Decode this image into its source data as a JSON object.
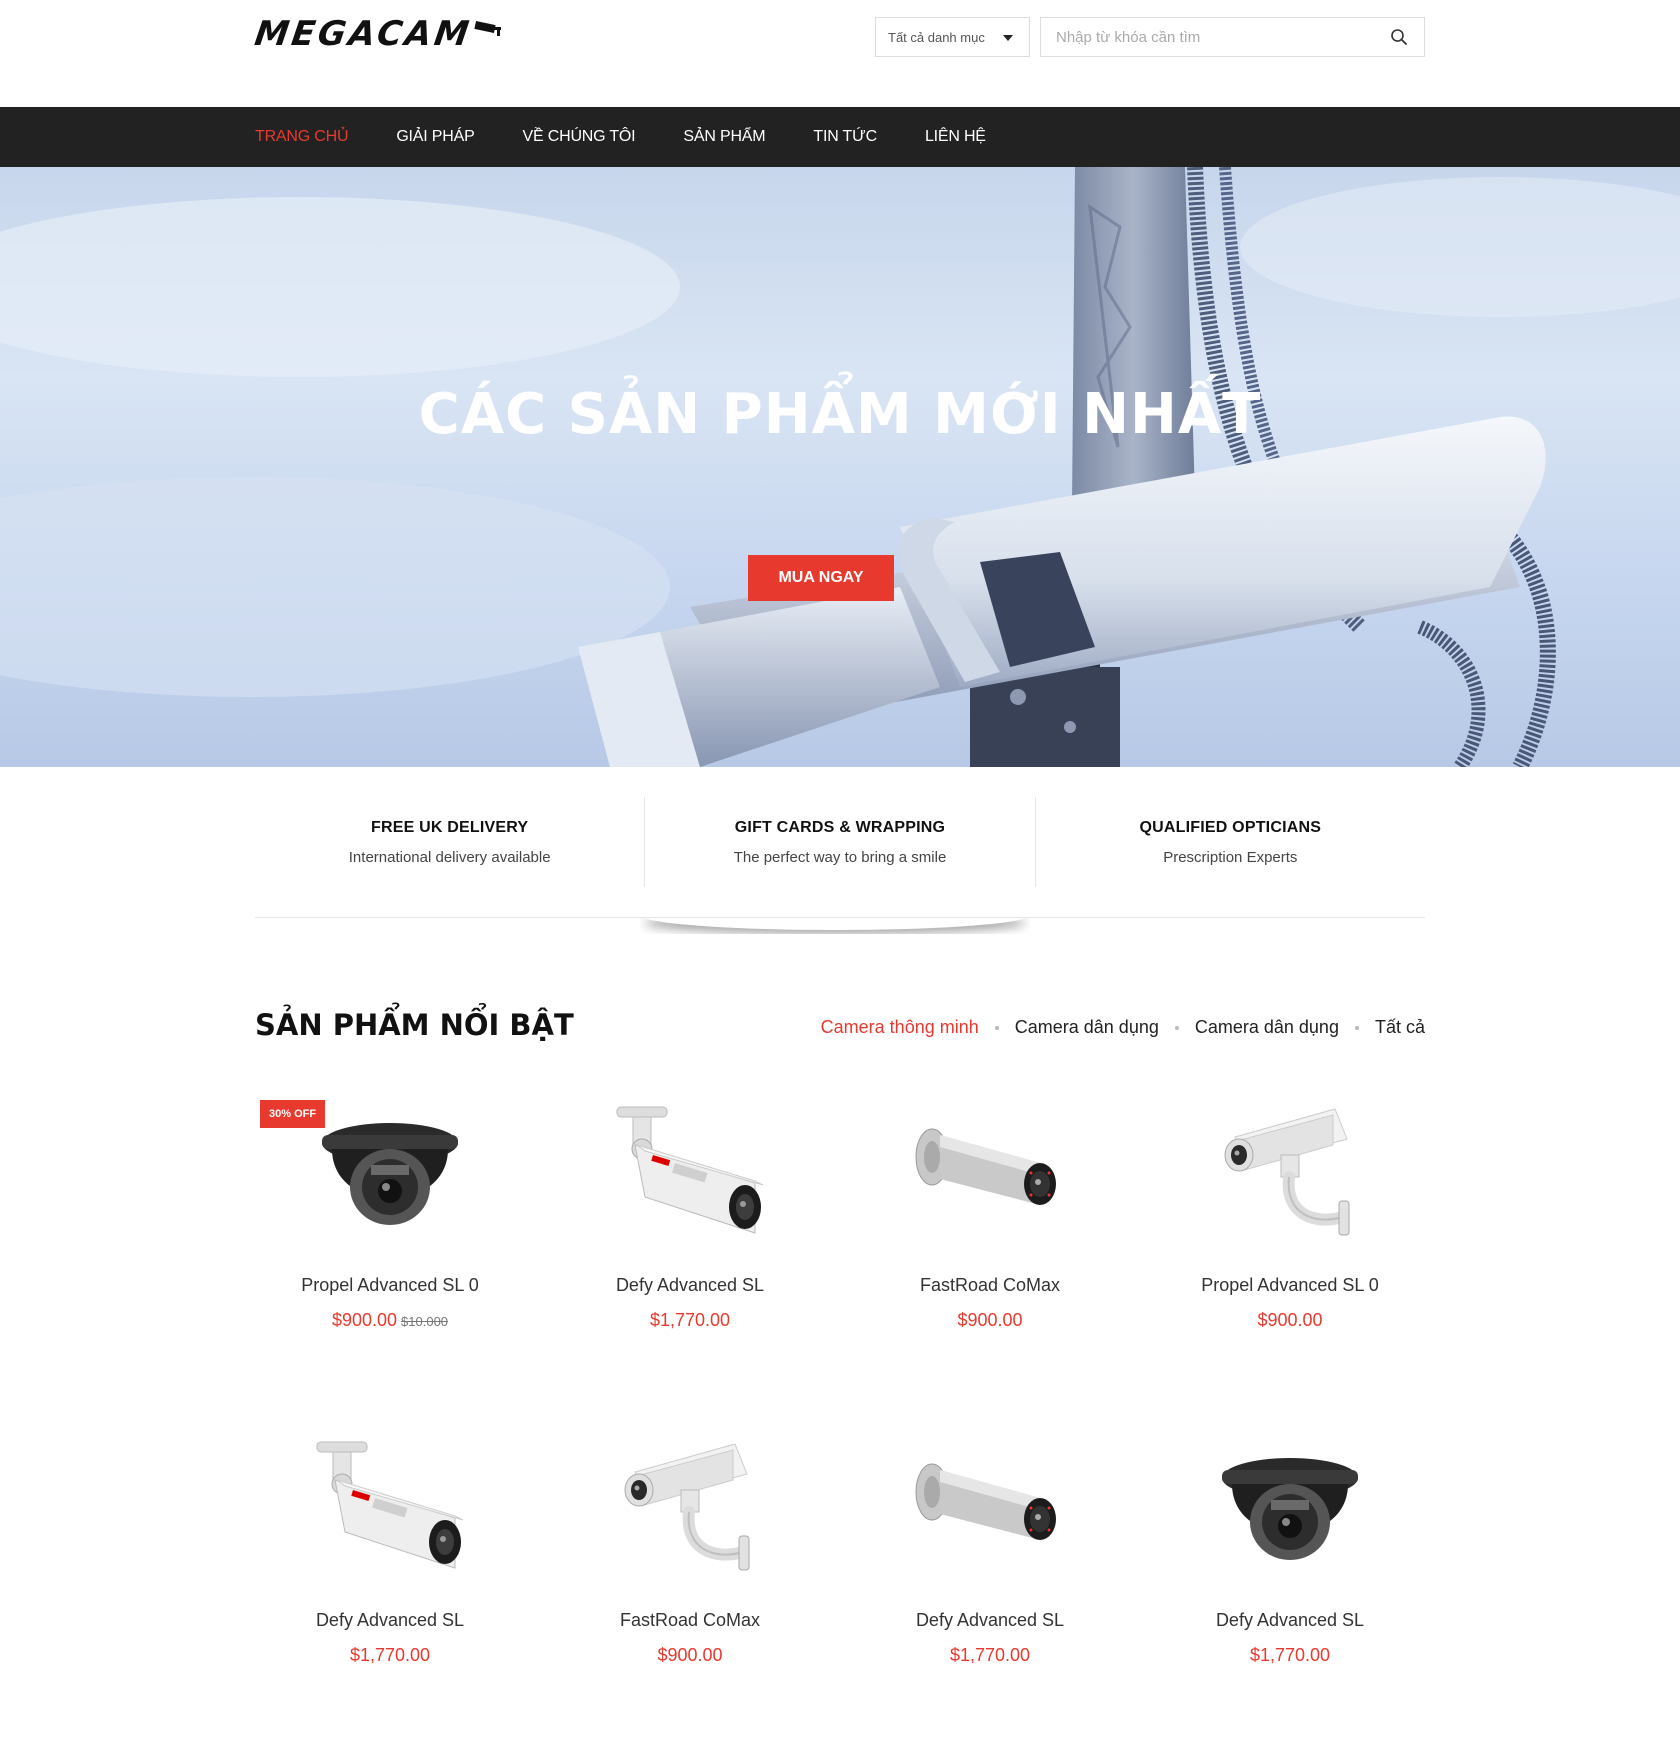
{
  "header": {
    "logo_text": "MEGACAM",
    "category_select": "Tất cả danh mục",
    "search_placeholder": "Nhập từ khóa cần tìm"
  },
  "nav": {
    "items": [
      {
        "label": "TRANG CHỦ",
        "active": true
      },
      {
        "label": "GIẢI PHÁP"
      },
      {
        "label": "VỀ CHÚNG TÔI"
      },
      {
        "label": "SẢN PHẨM"
      },
      {
        "label": "TIN TỨC"
      },
      {
        "label": "LIÊN HỆ"
      }
    ]
  },
  "hero": {
    "title": "CÁC SẢN PHẨM MỚI NHẤT",
    "button": "MUA NGAY"
  },
  "features": [
    {
      "title": "FREE UK DELIVERY",
      "text": "International delivery available"
    },
    {
      "title": "GIFT CARDS & WRAPPING",
      "text": "The perfect way to bring a smile"
    },
    {
      "title": "QUALIFIED OPTICIANS",
      "text": "Prescription Experts"
    }
  ],
  "featured": {
    "title": "SẢN PHẨM NỔI BẬT",
    "filters": [
      "Camera thông minh",
      "Camera dân dụng",
      "Camera dân dụng",
      "Tất cả"
    ],
    "products": [
      {
        "name": "Propel Advanced SL 0",
        "price": "$900.00",
        "old_price": "$10.000",
        "badge": "30% OFF",
        "icon": "dome-camera-icon"
      },
      {
        "name": "Defy Advanced SL",
        "price": "$1,770.00",
        "icon": "bullet-camera-icon"
      },
      {
        "name": "FastRoad CoMax",
        "price": "$900.00",
        "icon": "tube-camera-icon"
      },
      {
        "name": "Propel Advanced SL 0",
        "price": "$900.00",
        "icon": "box-camera-icon"
      },
      {
        "name": "Defy Advanced SL",
        "price": "$1,770.00",
        "icon": "bullet-camera-icon"
      },
      {
        "name": "FastRoad CoMax",
        "price": "$900.00",
        "icon": "box-camera-icon"
      },
      {
        "name": "Defy Advanced SL",
        "price": "$1,770.00",
        "icon": "tube-camera-icon"
      },
      {
        "name": "Defy Advanced SL",
        "price": "$1,770.00",
        "icon": "dome-camera-icon"
      }
    ]
  },
  "colors": {
    "accent": "#e8392e",
    "nav_bg": "#222222"
  }
}
